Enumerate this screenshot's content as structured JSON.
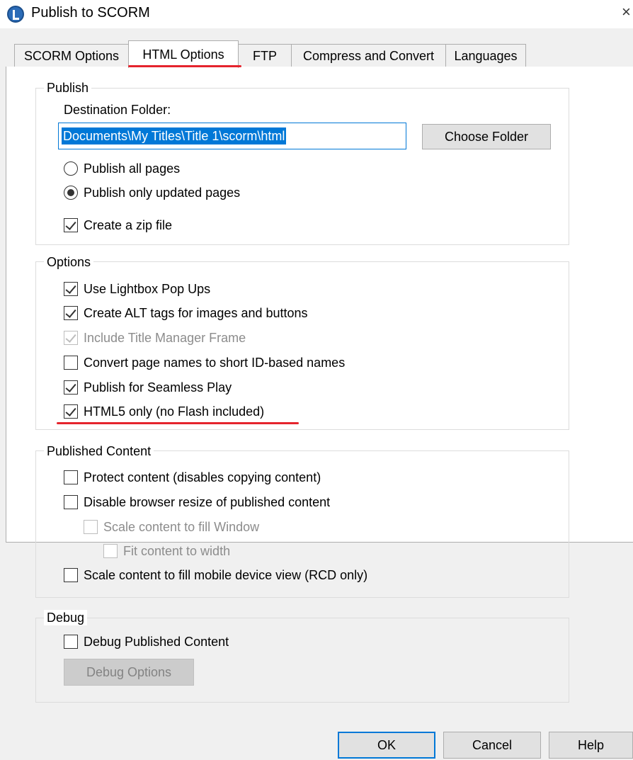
{
  "window": {
    "title": "Publish to SCORM",
    "close_glyph": "×"
  },
  "tabs": [
    {
      "label": "SCORM Options",
      "active": false
    },
    {
      "label": "HTML Options",
      "active": true
    },
    {
      "label": "FTP",
      "active": false
    },
    {
      "label": "Compress and Convert",
      "active": false
    },
    {
      "label": "Languages",
      "active": false
    }
  ],
  "publish": {
    "group_title": "Publish",
    "destination_label": "Destination Folder:",
    "destination_value": "Documents\\My Titles\\Title 1\\scorm\\html",
    "choose_folder_label": "Choose Folder",
    "radio_all_label": "Publish all pages",
    "radio_updated_label": "Publish only updated pages",
    "selected_radio": "Publish only updated pages",
    "zip_label": "Create a zip file",
    "zip_checked": true
  },
  "options": {
    "group_title": "Options",
    "items": [
      {
        "label": "Use Lightbox Pop Ups",
        "checked": true,
        "disabled": false
      },
      {
        "label": "Create ALT tags for images and buttons",
        "checked": true,
        "disabled": false
      },
      {
        "label": "Include Title Manager Frame",
        "checked": true,
        "disabled": true
      },
      {
        "label": "Convert page names to short ID-based names",
        "checked": false,
        "disabled": false
      },
      {
        "label": "Publish for Seamless Play",
        "checked": true,
        "disabled": false
      },
      {
        "label": "HTML5 only (no Flash included)",
        "checked": true,
        "disabled": false
      }
    ]
  },
  "published_content": {
    "group_title": "Published Content",
    "items": [
      {
        "label": "Protect content (disables copying content)",
        "checked": false,
        "disabled": false
      },
      {
        "label": "Disable browser resize of published content",
        "checked": false,
        "disabled": false
      },
      {
        "label": "Scale content to fill Window",
        "checked": false,
        "disabled": true
      },
      {
        "label": "Fit content to width",
        "checked": false,
        "disabled": true
      },
      {
        "label": "Scale content to fill mobile device view (RCD only)",
        "checked": false,
        "disabled": false
      }
    ]
  },
  "debug": {
    "group_title": "Debug",
    "debug_label": "Debug Published Content",
    "debug_checked": false,
    "debug_options_label": "Debug Options"
  },
  "footer": {
    "ok_label": "OK",
    "cancel_label": "Cancel",
    "help_label": "Help"
  },
  "colors": {
    "highlight": "#0078d7",
    "annotation_red": "#e5242d"
  }
}
